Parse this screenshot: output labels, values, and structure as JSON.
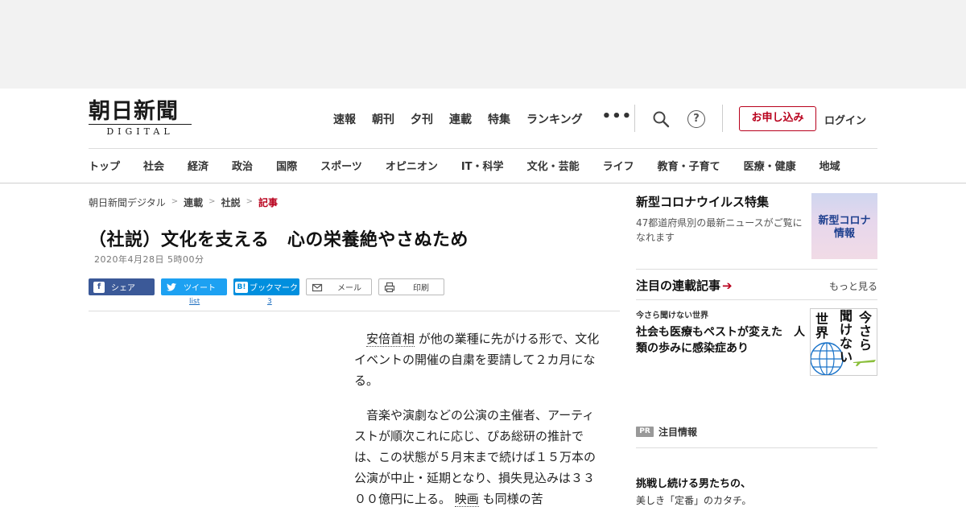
{
  "logo": {
    "kanji": "朝日新聞",
    "sub": "DIGITAL"
  },
  "topnav": [
    "速報",
    "朝刊",
    "夕刊",
    "連載",
    "特集",
    "ランキング"
  ],
  "topnav_more": "•••",
  "help_symbol": "?",
  "subscribe_label": "お申し込み",
  "login_label": "ログイン",
  "categories": [
    "トップ",
    "社会",
    "経済",
    "政治",
    "国際",
    "スポーツ",
    "オピニオン",
    "IT・科学",
    "文化・芸能",
    "ライフ",
    "教育・子育て",
    "医療・健康",
    "地域"
  ],
  "breadcrumb": {
    "home": "朝日新聞デジタル",
    "sep": ">",
    "serial": "連載",
    "editorial": "社説",
    "current": "記事"
  },
  "article": {
    "title": "（社説）文化を支える　心の栄養絶やさぬため",
    "date": "2020年4月28日 5時00分",
    "p1_link": "安倍首相",
    "p1_rest": "が他の業種に先がける形で、文化イベントの開催の自粛を要請して２カ月になる。",
    "p2_start": "音楽や演劇などの公演の主催者、アーティストが順次これに応じ、ぴあ総研の推計では、この状態が５月末まで続けば１５万本の公演が中止・延期となり、損失見込みは３３００億円に上る。",
    "p2_link": "映画",
    "p2_end": "も同様の苦"
  },
  "share": {
    "facebook": "シェア",
    "twitter": "ツイート",
    "twitter_count": "list",
    "hatena_icon": "B!",
    "hatena": "ブックマーク",
    "hatena_count": "3",
    "mail": "メール",
    "print": "印刷"
  },
  "sidebar": {
    "covid_title": "新型コロナウイルス特集",
    "covid_desc": "47都道府県別の最新ニュースがご覧になれます",
    "covid_thumb_1": "新型コロナ",
    "covid_thumb_2": "情報",
    "featured_title": "注目の連載記事",
    "featured_arrow": "➔",
    "featured_more": "もっと見る",
    "serial_kicker": "今さら聞けない世界",
    "serial_title": "社会も医療もペストが変えた　人類の歩みに感染症あり",
    "serial_thumb": {
      "col1": "世界",
      "col2": "聞けない",
      "col3": "今さら"
    },
    "pr_badge": "PR",
    "pr_label": "注目情報",
    "promo_title": "挑戦し続ける男たちの、",
    "promo_sub": "美しき「定番」のカタチ。"
  },
  "colors": {
    "brand_red": "#b8001c",
    "facebook": "#3b5998",
    "twitter": "#1da1f2",
    "hatena": "#008fde"
  }
}
